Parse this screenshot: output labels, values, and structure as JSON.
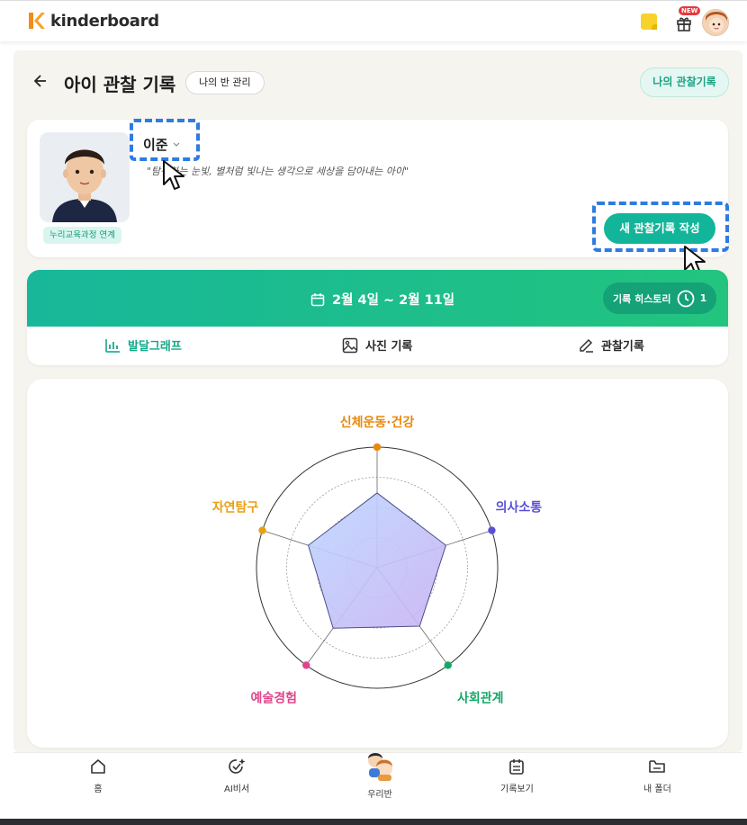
{
  "header": {
    "brand": "kinderboard",
    "new_badge": "NEW"
  },
  "page": {
    "title": "아이 관찰 기록",
    "my_class_button": "나의 반 관리",
    "my_records_button": "나의 관찰기록"
  },
  "profile": {
    "child_name": "이준",
    "quote": "\"탐구하는 눈빛, 별처럼 빛나는 생각으로 세상을 담아내는 아이\"",
    "curriculum_badge": "누리교육과정 연계",
    "new_record_button": "새 관찰기록 작성"
  },
  "period": {
    "date_range": "2월 4일 ~ 2월 11일",
    "history_label": "기록 히스토리",
    "history_count": "1"
  },
  "tabs": [
    {
      "label": "발달그래프",
      "icon": "bar-chart-icon",
      "active": true
    },
    {
      "label": "사진 기록",
      "icon": "image-icon",
      "active": false
    },
    {
      "label": "관찰기록",
      "icon": "pencil-icon",
      "active": false
    }
  ],
  "chart_data": {
    "type": "radar",
    "axes": [
      {
        "label": "신체운동·건강",
        "color": "#e8890c",
        "value": 0.62
      },
      {
        "label": "의사소통",
        "color": "#5a4fd6",
        "value": 0.6
      },
      {
        "label": "사회관계",
        "color": "#14a868",
        "value": 0.6
      },
      {
        "label": "예술경험",
        "color": "#e0448a",
        "value": 0.62
      },
      {
        "label": "자연탐구",
        "color": "#e8a012",
        "value": 0.6
      }
    ],
    "rings": 4,
    "fill_colors": [
      "#bcd7ff",
      "#c9b2f3"
    ]
  },
  "bottom_nav": [
    {
      "label": "홈",
      "icon": "home-icon"
    },
    {
      "label": "AI비서",
      "icon": "ai-assistant-icon"
    },
    {
      "label": "우리반",
      "icon": "our-class-icon"
    },
    {
      "label": "기록보기",
      "icon": "calendar-icon"
    },
    {
      "label": "내 폴더",
      "icon": "folder-icon"
    }
  ],
  "colors": {
    "accent": "#13b59a",
    "highlight": "#2f7be0"
  }
}
